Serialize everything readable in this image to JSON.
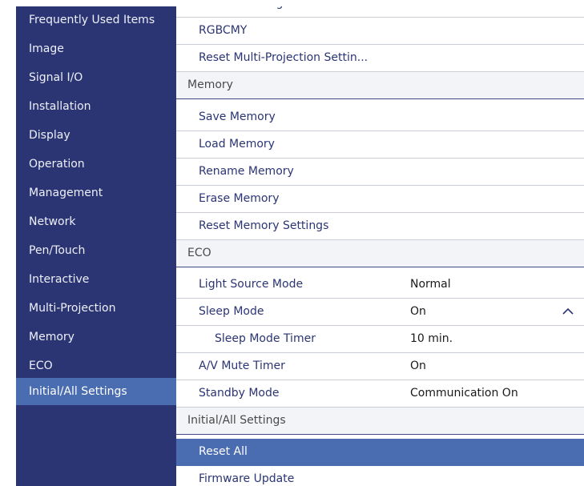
{
  "sidebar": {
    "items": [
      {
        "label": "Frequently Used Items"
      },
      {
        "label": "Image"
      },
      {
        "label": "Signal I/O"
      },
      {
        "label": "Installation"
      },
      {
        "label": "Display"
      },
      {
        "label": "Operation"
      },
      {
        "label": "Management"
      },
      {
        "label": "Network"
      },
      {
        "label": "Pen/Touch"
      },
      {
        "label": "Interactive"
      },
      {
        "label": "Multi-Projection"
      },
      {
        "label": "Memory"
      },
      {
        "label": "ECO"
      },
      {
        "label": "Initial/All Settings"
      }
    ],
    "selected": "Initial/All Settings"
  },
  "main": {
    "rows": [
      {
        "label": "Color Matching"
      },
      {
        "label": "RGBCMY"
      },
      {
        "label": "Reset Multi-Projection Settin..."
      },
      {
        "label": "Memory"
      },
      {
        "label": "Save Memory"
      },
      {
        "label": "Load Memory"
      },
      {
        "label": "Rename Memory"
      },
      {
        "label": "Erase Memory"
      },
      {
        "label": "Reset Memory Settings"
      },
      {
        "label": "ECO"
      },
      {
        "label": "Light Source Mode",
        "value": "Normal"
      },
      {
        "label": "Sleep Mode",
        "value": "On"
      },
      {
        "label": "Sleep Mode Timer",
        "value": "10 min."
      },
      {
        "label": "A/V Mute Timer",
        "value": "On"
      },
      {
        "label": "Standby Mode",
        "value": "Communication On"
      },
      {
        "label": "Initial/All Settings"
      },
      {
        "label": "Reset All"
      },
      {
        "label": "Firmware Update"
      }
    ],
    "expanded_icon": "chevron-up-icon"
  },
  "colors": {
    "sidebar_bg": "#2b3574",
    "selection": "#4a6cb0",
    "item_text": "#2b3574"
  }
}
